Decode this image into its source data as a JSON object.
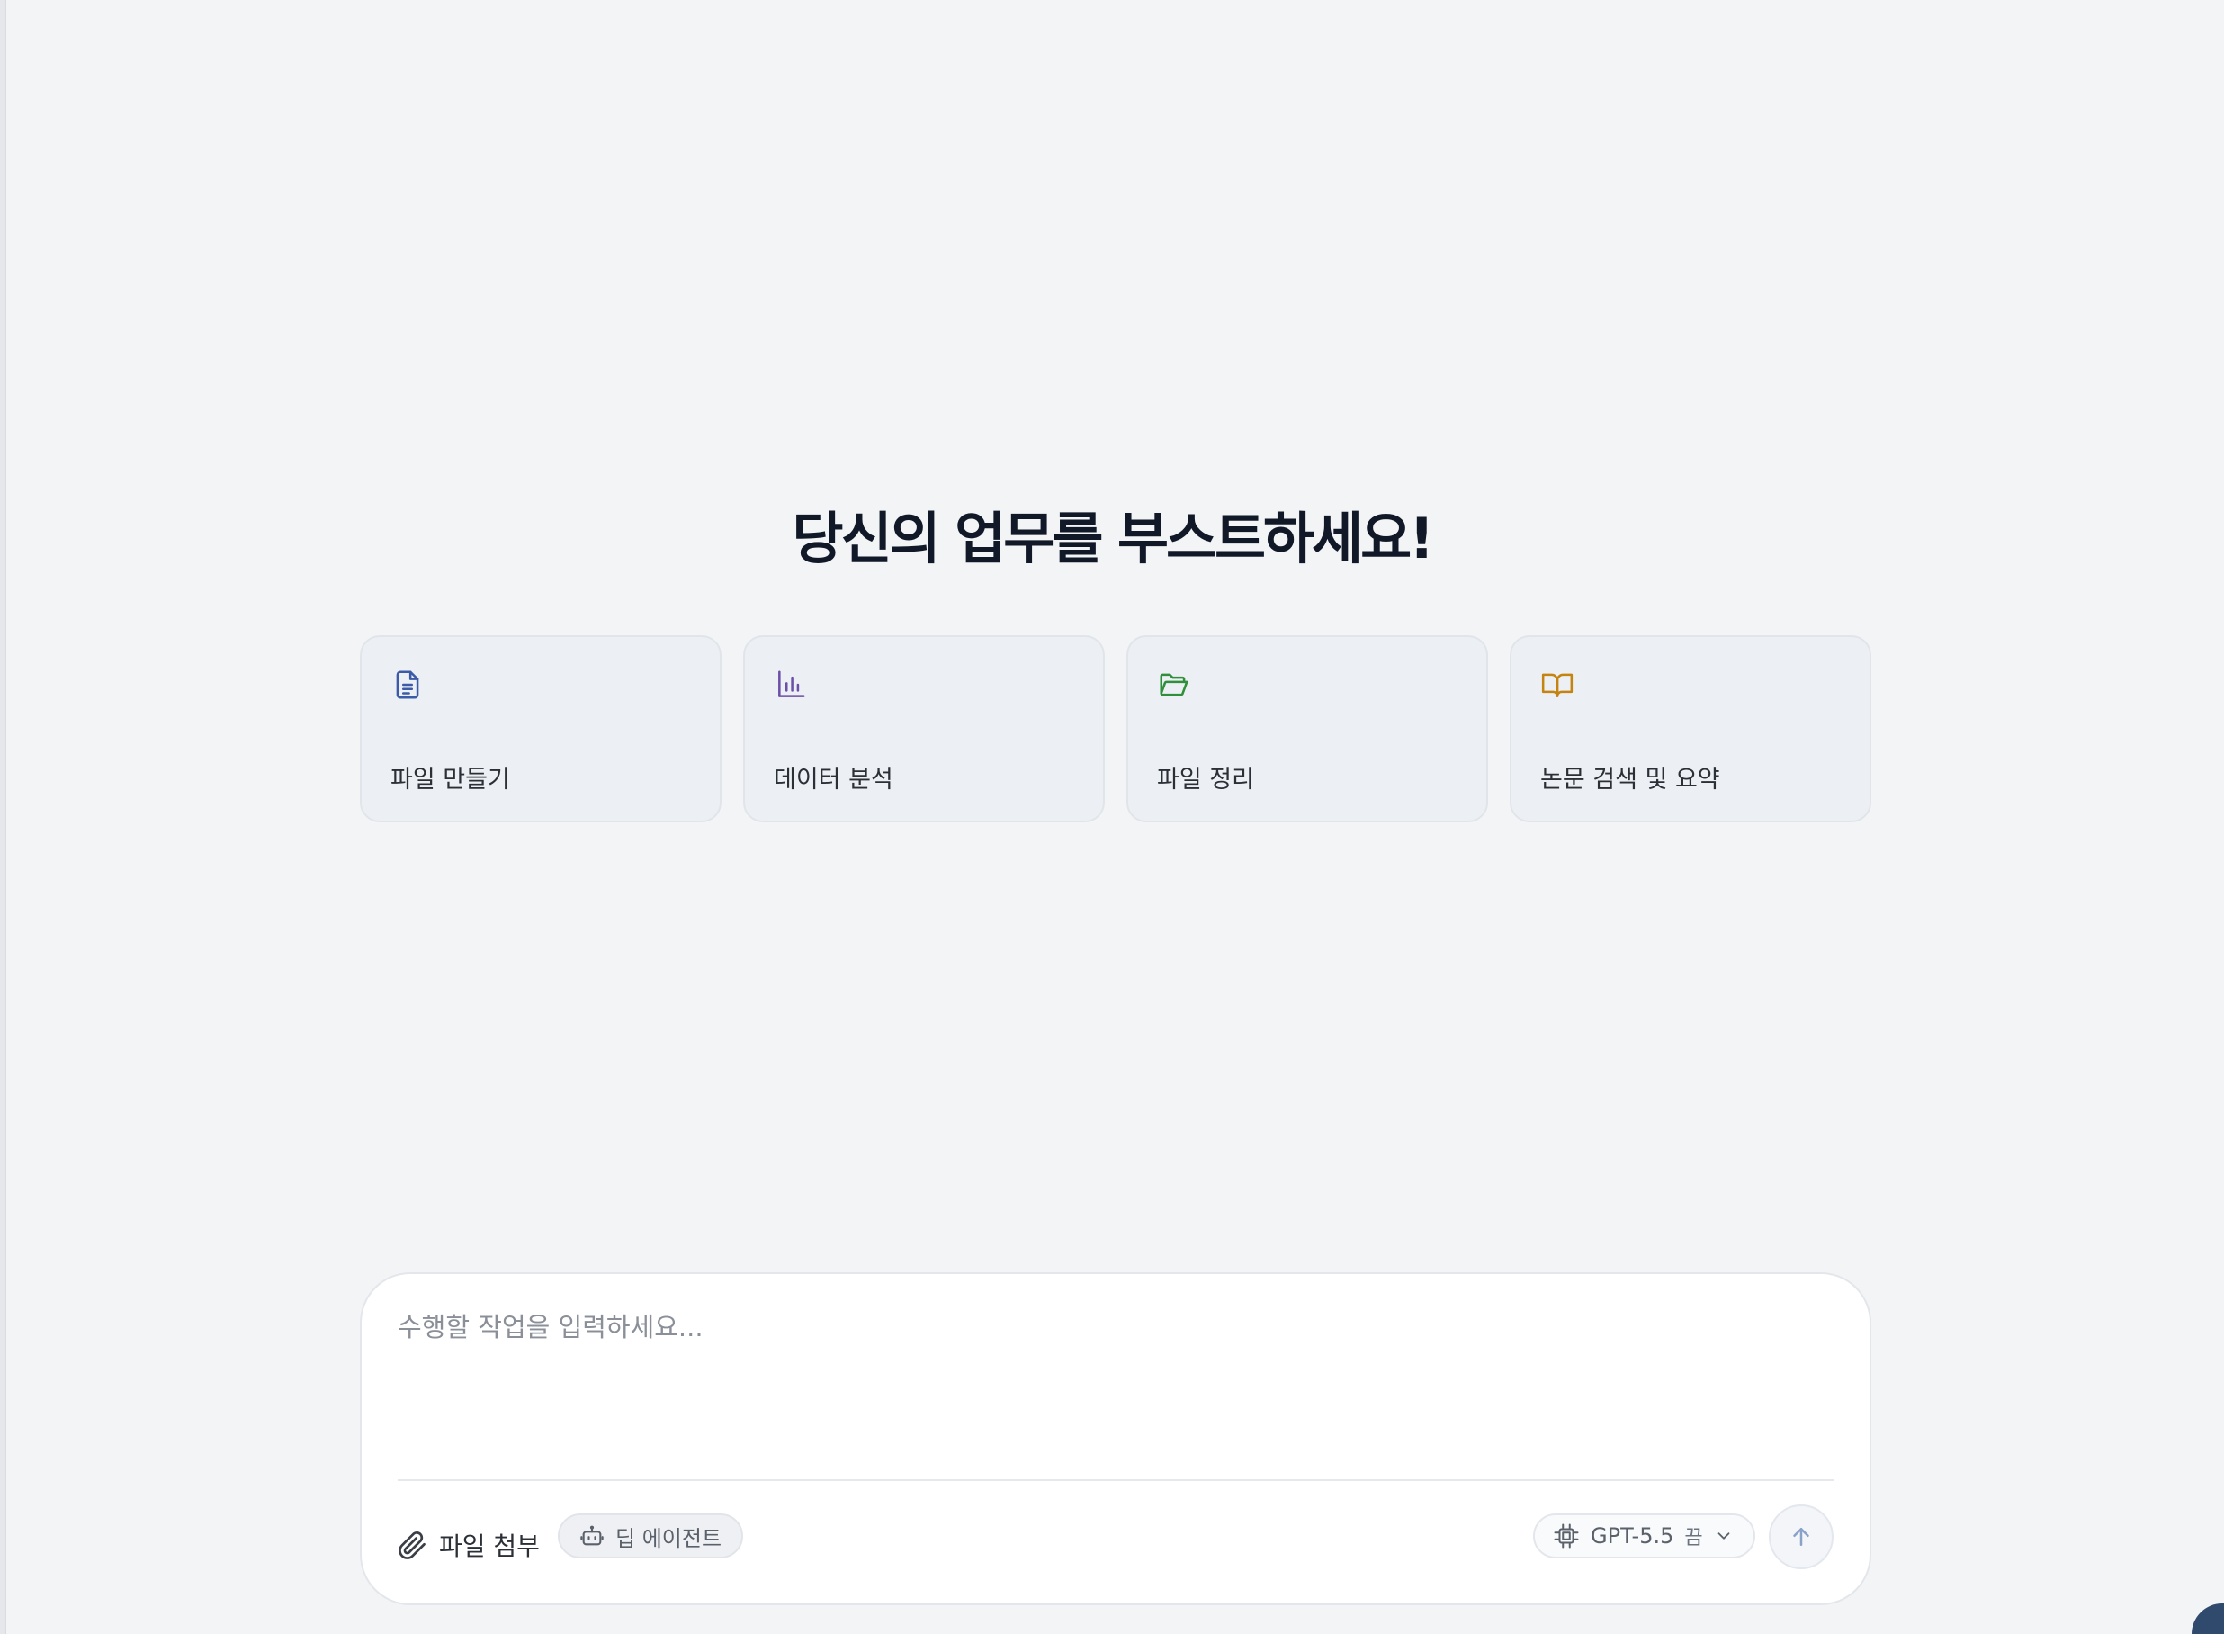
{
  "main": {
    "headline": "당신의 업무를 부스트하세요!",
    "cards": [
      {
        "label": "파일 만들기",
        "icon": "document-icon",
        "color": "#3b5ba8"
      },
      {
        "label": "데이터 분석",
        "icon": "bar-chart-icon",
        "color": "#6d4ea8"
      },
      {
        "label": "파일 정리",
        "icon": "folder-open-icon",
        "color": "#2f8f3a"
      },
      {
        "label": "논문 검색 및 요약",
        "icon": "book-open-icon",
        "color": "#c58312"
      }
    ]
  },
  "composer": {
    "placeholder": "수행할 작업을 입력하세요...",
    "attach_label": "파일 첨부",
    "agent_label": "딥 에이전트",
    "model_label": "GPT-5.5",
    "model_toggle": "끔",
    "send_icon": "arrow-up-icon"
  }
}
